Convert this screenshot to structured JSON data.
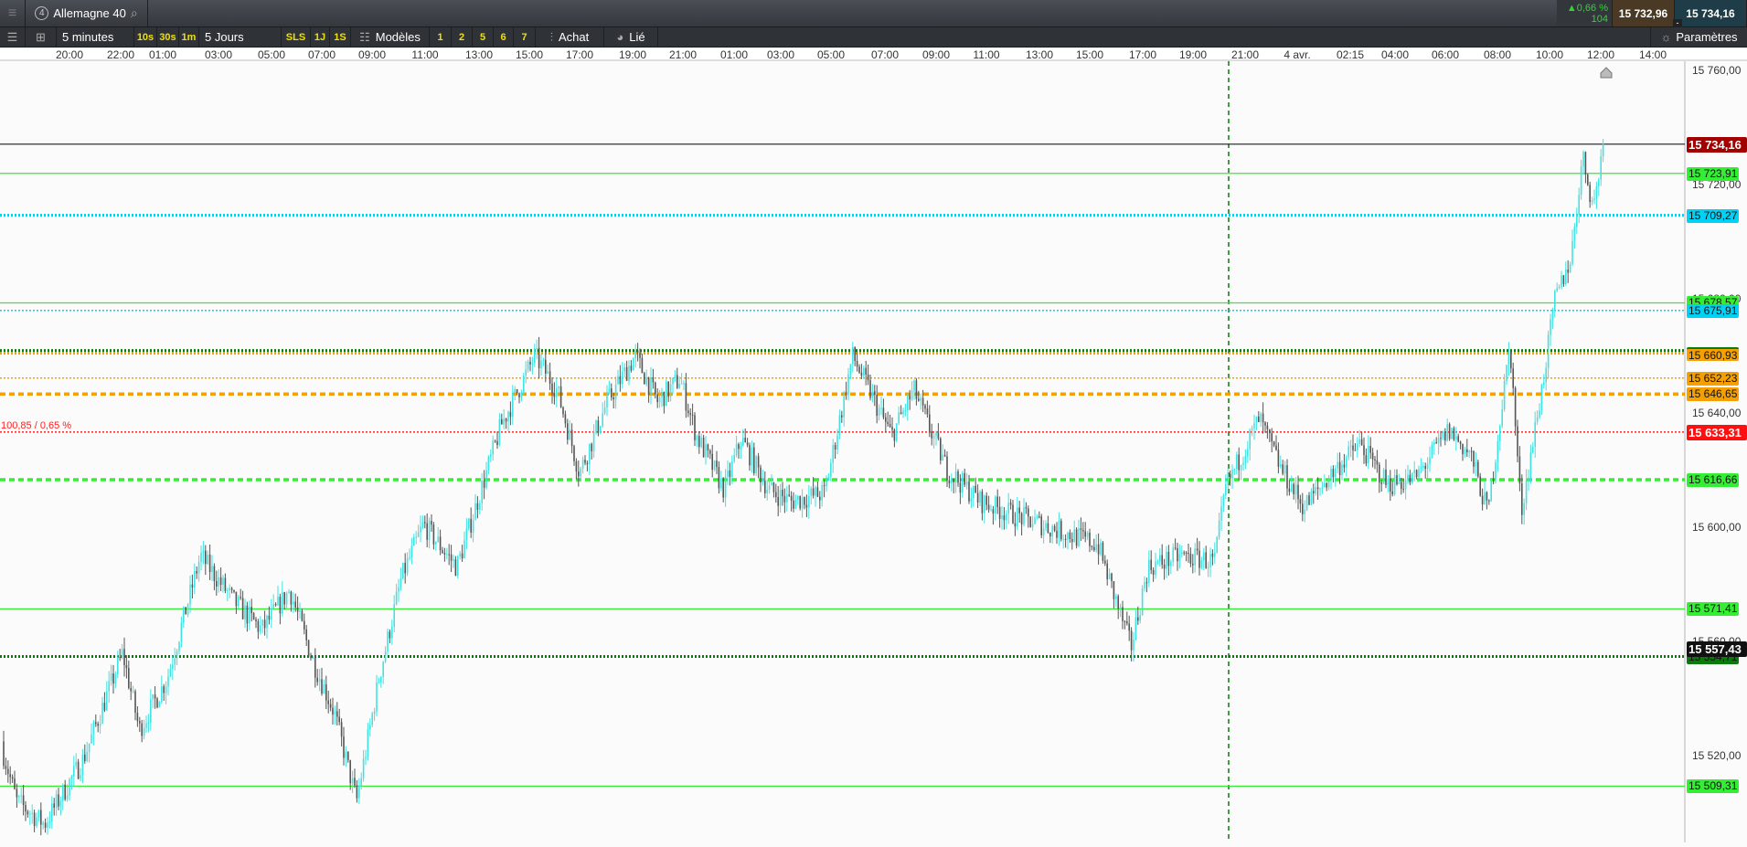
{
  "header": {
    "menu_icon": "hamburger-icon",
    "instrument_number": "4",
    "instrument": "Allemagne 40",
    "search_icon": "search-icon",
    "change_pct": "0,66 %",
    "change_pts": "104",
    "bid": "15 732,96",
    "ask": "15 734,16",
    "spread_toggle": "-"
  },
  "toolbar": {
    "period": "5 minutes",
    "quick_periods": [
      "10s",
      "30s",
      "1m"
    ],
    "range": "5 Jours",
    "range_buttons": [
      "SLS",
      "1J",
      "1S"
    ],
    "models": "Modèles",
    "presets": [
      "1",
      "2",
      "5",
      "6",
      "7"
    ],
    "buy": "Achat",
    "linked": "Lié",
    "settings": "Paramètres"
  },
  "chart_data": {
    "type": "candlestick",
    "instrument": "Allemagne 40",
    "interval": "5 minutes",
    "x_ticks": [
      "20:00",
      "22:00",
      "01:00",
      "03:00",
      "05:00",
      "07:00",
      "09:00",
      "11:00",
      "13:00",
      "15:00",
      "17:00",
      "19:00",
      "21:00",
      "01:00",
      "03:00",
      "05:00",
      "07:00",
      "09:00",
      "11:00",
      "13:00",
      "15:00",
      "17:00",
      "19:00",
      "21:00",
      "4 avr.",
      "02:15",
      "04:00",
      "06:00",
      "08:00",
      "10:00",
      "12:00",
      "14:00"
    ],
    "y_ticks": [
      "15 760,00",
      "15 720,00",
      "15 680,00",
      "15 640,00",
      "15 600,00",
      "15 560,00",
      "15 520,00"
    ],
    "ylim": [
      15487,
      15760
    ],
    "price_path": [
      15525,
      15504,
      15496,
      15519,
      15556,
      15529,
      15547,
      15590,
      15574,
      15564,
      15578,
      15554,
      15535,
      15504,
      15547,
      15582,
      15601,
      15586,
      15636,
      15660,
      15648,
      15619,
      15644,
      15660,
      15644,
      15652,
      15632,
      15613,
      15631,
      15613,
      15609,
      15612,
      15660,
      15632,
      15648,
      15620,
      15609,
      15605,
      15594,
      15558,
      15586,
      15590,
      15588,
      15614,
      15638,
      15620,
      15607,
      15621,
      15629,
      15615,
      15617,
      15634,
      15625,
      15605,
      15664,
      15605,
      15652,
      15679,
      15695,
      15730,
      15712,
      15738
    ],
    "levels": [
      {
        "price": 15734.16,
        "label": "15 734,16",
        "color": "#333333",
        "style": "solid",
        "tag_bg": "#a30000",
        "tag_fg": "#ffffff"
      },
      {
        "price": 15723.91,
        "label": "15 723,91",
        "color": "#33ee33",
        "style": "solid",
        "tag_bg": "#33ee33"
      },
      {
        "price": 15709.27,
        "label": "15 709,27",
        "color": "#00d2f5",
        "style": "dotted",
        "tag_bg": "#00d2f5"
      },
      {
        "price": 15678.57,
        "label": "15 678,57",
        "color": "#33ee33",
        "style": "solid",
        "tag_bg": "#33ee33"
      },
      {
        "price": 15675.91,
        "label": "15 675,91",
        "color": "#00d2f5",
        "style": "dotted-thin",
        "tag_bg": "#00d2f5"
      },
      {
        "price": 15660.93,
        "label": "15 660,93",
        "color": "#f5a000",
        "style": "dotted",
        "tag_bg": "#f5a000",
        "second_color": "#0a7a0a"
      },
      {
        "price": 15652.23,
        "label": "15 652,23",
        "color": "#f5a000",
        "style": "dotted-thin",
        "tag_bg": "#f5a000"
      },
      {
        "price": 15646.65,
        "label": "15 646,65",
        "color": "#f5a000",
        "style": "dashed",
        "tag_bg": "#f5a000"
      },
      {
        "price": 15633.31,
        "label": "15 633,31",
        "color": "#ff2020",
        "style": "dotted-thin",
        "tag_bg": "#ff1010",
        "tag_fg": "#ffffff",
        "left_text": "100,85 / 0,65 %"
      },
      {
        "price": 15616.66,
        "label": "15 616,66",
        "color": "#33ee33",
        "style": "dashed",
        "tag_bg": "#33ee33"
      },
      {
        "price": 15571.41,
        "label": "15 571,41",
        "color": "#33ee33",
        "style": "solid",
        "tag_bg": "#33ee33"
      },
      {
        "price": 15554.71,
        "label": "15 554,71",
        "color": "#0a7a0a",
        "style": "dotted",
        "tag_bg": "#0a7a0a"
      },
      {
        "price": 15557.43,
        "label": "15 557,43",
        "color": "none",
        "style": "none",
        "tag_bg": "#111111",
        "tag_fg": "#ffffff"
      },
      {
        "price": 15509.31,
        "label": "15 509,31",
        "color": "#33ee33",
        "style": "solid",
        "tag_bg": "#33ee33"
      }
    ],
    "up_color": "#3fe3e3",
    "down_color": "#555555",
    "session_marker": "4 avr."
  }
}
